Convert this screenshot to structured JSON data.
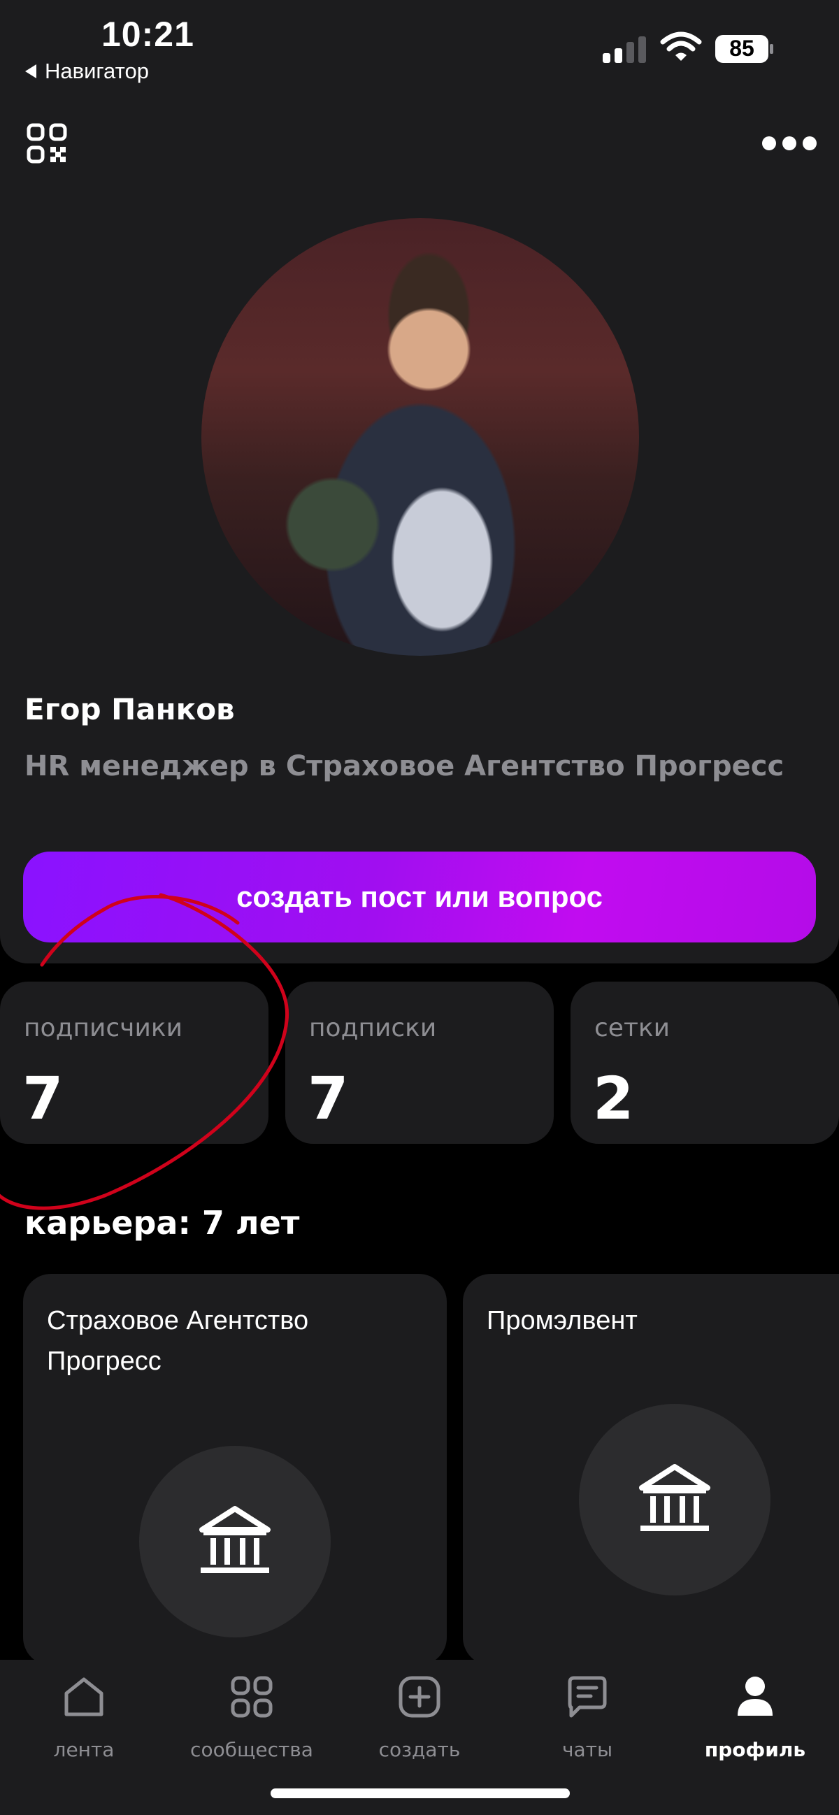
{
  "status_bar": {
    "time": "10:21",
    "back_label": "Навигатор",
    "battery": "85"
  },
  "profile": {
    "name": "Егор Панков",
    "position": "HR менеджер в Страховое Агентство Прогресс",
    "create_button": "создать пост или вопрос"
  },
  "stats": [
    {
      "label": "подписчики",
      "value": "7"
    },
    {
      "label": "подписки",
      "value": "7"
    },
    {
      "label": "сетки",
      "value": "2"
    }
  ],
  "career": {
    "title": "карьера: 7 лет",
    "companies": [
      {
        "name": "Страховое Агентство Прогресс",
        "icon": "bank-icon"
      },
      {
        "name": "Промэлвент",
        "icon": "bank-icon"
      }
    ]
  },
  "bottom_nav": {
    "items": [
      {
        "label": "лента",
        "icon": "home-icon"
      },
      {
        "label": "сообщества",
        "icon": "grid-icon"
      },
      {
        "label": "создать",
        "icon": "plus-square-icon"
      },
      {
        "label": "чаты",
        "icon": "chat-icon"
      },
      {
        "label": "профиль",
        "icon": "person-icon",
        "active": true
      }
    ]
  },
  "colors": {
    "background": "#000000",
    "card": "#1c1c1e",
    "accent_gradient_start": "#8a12ff",
    "accent_gradient_end": "#c10cf0",
    "muted_text": "#8e8e93",
    "annotation": "#d0021b"
  }
}
